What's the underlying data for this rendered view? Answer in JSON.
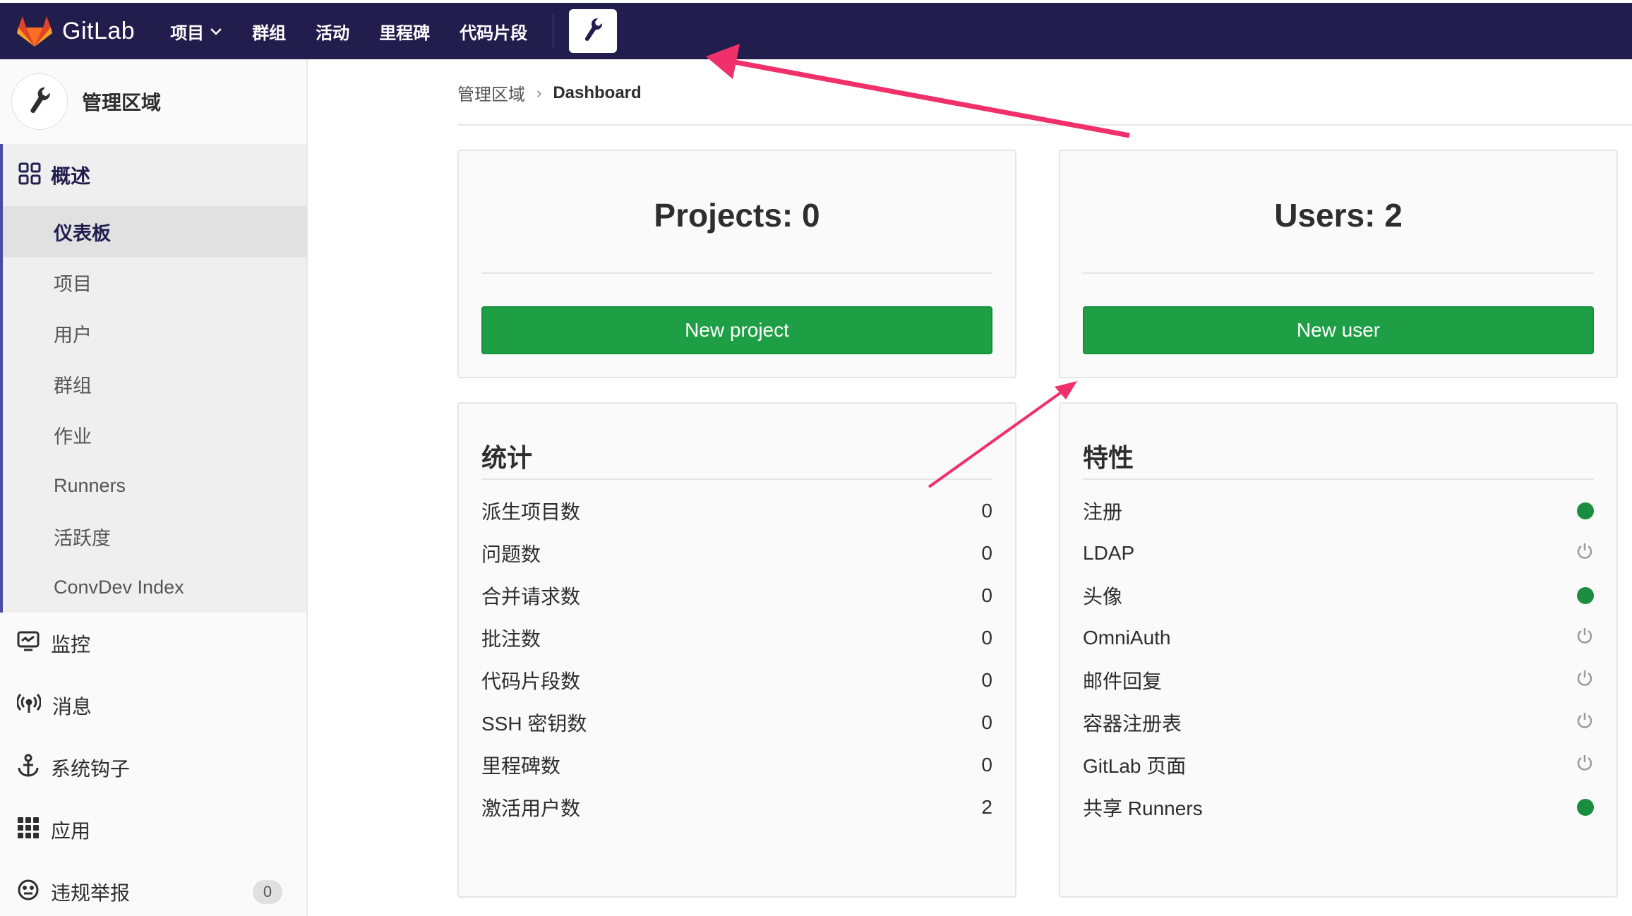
{
  "topbar": {
    "brand": "GitLab",
    "nav": [
      "项目",
      "群组",
      "活动",
      "里程碑",
      "代码片段"
    ],
    "admin_icon": "wrench-icon"
  },
  "sidebar": {
    "title": "管理区域",
    "overview": {
      "label": "概述",
      "items": [
        "仪表板",
        "项目",
        "用户",
        "群组",
        "作业",
        "Runners",
        "活跃度",
        "ConvDev Index"
      ]
    },
    "items": [
      {
        "label": "监控",
        "icon": "monitor-icon"
      },
      {
        "label": "消息",
        "icon": "broadcast-icon"
      },
      {
        "label": "系统钩子",
        "icon": "anchor-icon"
      },
      {
        "label": "应用",
        "icon": "grid-icon"
      },
      {
        "label": "违规举报",
        "icon": "face-icon",
        "badge": "0"
      }
    ]
  },
  "breadcrumb": {
    "parent": "管理区域",
    "current": "Dashboard"
  },
  "projects_card": {
    "title": "Projects: 0",
    "button": "New project"
  },
  "users_card": {
    "title": "Users: 2",
    "button": "New user"
  },
  "stats": {
    "title": "统计",
    "rows": [
      {
        "label": "派生项目数",
        "value": "0"
      },
      {
        "label": "问题数",
        "value": "0"
      },
      {
        "label": "合并请求数",
        "value": "0"
      },
      {
        "label": "批注数",
        "value": "0"
      },
      {
        "label": "代码片段数",
        "value": "0"
      },
      {
        "label": "SSH 密钥数",
        "value": "0"
      },
      {
        "label": "里程碑数",
        "value": "0"
      },
      {
        "label": "激活用户数",
        "value": "2"
      }
    ]
  },
  "features": {
    "title": "特性",
    "rows": [
      {
        "label": "注册",
        "enabled": true
      },
      {
        "label": "LDAP",
        "enabled": false
      },
      {
        "label": "头像",
        "enabled": true
      },
      {
        "label": "OmniAuth",
        "enabled": false
      },
      {
        "label": "邮件回复",
        "enabled": false
      },
      {
        "label": "容器注册表",
        "enabled": false
      },
      {
        "label": "GitLab 页面",
        "enabled": false
      },
      {
        "label": "共享 Runners",
        "enabled": true
      }
    ]
  },
  "colors": {
    "nav": "#211e4e",
    "button": "#1f9f45",
    "enabled": "#1a8d3e",
    "arrow": "#f0306a"
  }
}
